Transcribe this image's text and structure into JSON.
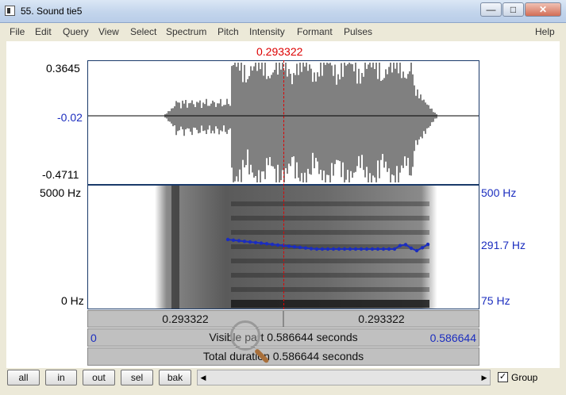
{
  "window": {
    "title": "55. Sound tie5"
  },
  "menu": {
    "items": [
      "File",
      "Edit",
      "Query",
      "View",
      "Select",
      "Spectrum",
      "Pitch",
      "Intensity",
      "Formant",
      "Pulses"
    ],
    "help": "Help"
  },
  "waveform": {
    "cursor_time": "0.293322",
    "y_max": "0.3645",
    "y_mid": "-0.02",
    "y_min": "-0.4711"
  },
  "spectrogram": {
    "freq_max": "5000 Hz",
    "freq_min": "0 Hz",
    "pitch_max": "500 Hz",
    "pitch_mid": "291.7 Hz",
    "pitch_min": "75 Hz"
  },
  "time_bars": {
    "left_segment": "0.293322",
    "right_segment": "0.293322",
    "visible_start": "0",
    "visible_label": "Visible part 0.586644 seconds",
    "visible_end": "0.586644",
    "total_label": "Total duration 0.586644 seconds"
  },
  "toolbar": {
    "all": "all",
    "in": "in",
    "out": "out",
    "sel": "sel",
    "bak": "bak",
    "group_label": "Group",
    "group_checked": true
  },
  "colors": {
    "cursor": "#dd0000",
    "pitch": "#1b2dbf",
    "axis_blue": "#1b2dbf"
  }
}
